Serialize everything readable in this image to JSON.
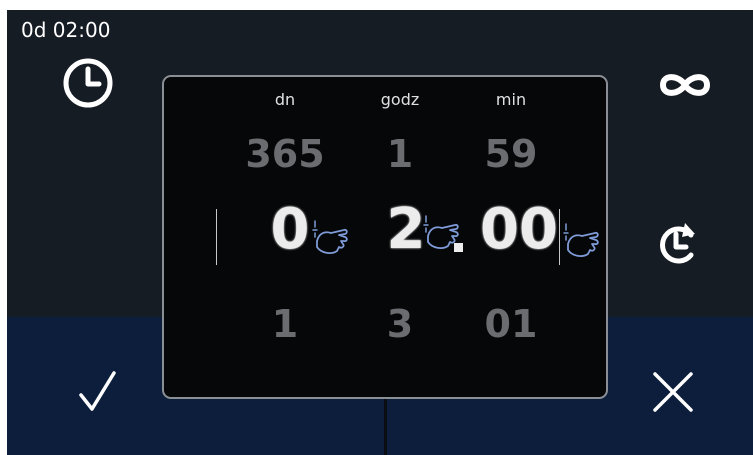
{
  "header": {
    "time_display": "0d 02:00"
  },
  "icons": {
    "clock": "clock-icon",
    "infinity": "infinity-icon",
    "repeat": "repeat-clock-icon",
    "confirm": "checkmark-icon",
    "cancel": "close-icon",
    "touch": "touch-hand-icon"
  },
  "picker": {
    "columns": [
      {
        "label": "dn",
        "prev": "365",
        "value": "0",
        "next": "1"
      },
      {
        "label": "godz",
        "prev": "1",
        "value": "2",
        "next": "3"
      },
      {
        "label": "min",
        "prev": "59",
        "value": "00",
        "next": "01"
      }
    ]
  },
  "colors": {
    "background": "#161c24",
    "bottom_panel": "#0d1e3c",
    "dialog_bg": "#060708",
    "dialog_border": "#8a8f96",
    "hand_icon": "#7f9bd8"
  }
}
